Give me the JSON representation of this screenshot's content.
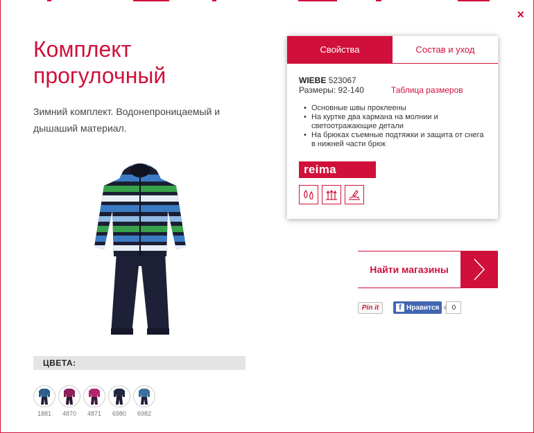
{
  "product": {
    "title": "Комплект прогулочный",
    "description": "Зимний комплект. Водонепроницаемый и дышаший материал."
  },
  "close_label": "×",
  "panel": {
    "tabs": [
      {
        "label": "Свойства",
        "active": true
      },
      {
        "label": "Состав и уход",
        "active": false
      }
    ],
    "model_name": "WIEBE",
    "model_code": "523067",
    "sizes_label": "Размеры: 92-140",
    "size_chart_link": "Таблица размеров",
    "features": [
      "Основные швы проклеены",
      "На куртке два кармана на молнии и светоотражающие детали",
      "На брюках съемные подтяжки и защита от снега в нижней части брюк"
    ],
    "brand_logo": "reima",
    "care_icons": [
      "water-drops-icon",
      "breathable-icon",
      "snow-protection-icon"
    ]
  },
  "find_stores": {
    "label": "Найти магазины"
  },
  "social": {
    "pinterest_label": "Pin it",
    "fb_like_label": "Нравится",
    "fb_count": "0"
  },
  "colors": {
    "heading": "ЦВЕТА:",
    "swatches": [
      {
        "code": "1881",
        "jacket": "#2f5e8c",
        "pants": "#1e2238"
      },
      {
        "code": "4870",
        "jacket": "#8c1f5a",
        "pants": "#2a1630"
      },
      {
        "code": "4871",
        "jacket": "#b3246f",
        "pants": "#3a1a3a"
      },
      {
        "code": "6980",
        "jacket": "#22273f",
        "pants": "#1a1c2e"
      },
      {
        "code": "6982",
        "jacket": "#3e6e9a",
        "pants": "#1e2238"
      }
    ]
  },
  "colors_theme": {
    "accent": "#d0103a",
    "facebook": "#4267b2"
  }
}
